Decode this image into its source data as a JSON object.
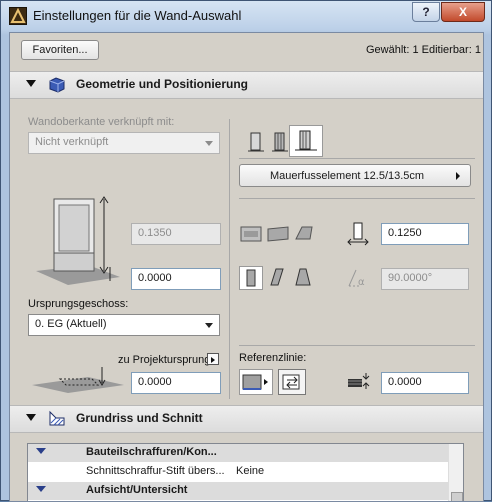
{
  "window": {
    "title": "Einstellungen für die Wand-Auswahl",
    "help_glyph": "?",
    "close_glyph": "X"
  },
  "top": {
    "favorites_label": "Favoriten...",
    "status_text": "Gewählt: 1 Editierbar: 1"
  },
  "section_geometry": {
    "label": "Geometrie und Positionierung"
  },
  "geometry": {
    "top_link_label": "Wandoberkante verknüpft mit:",
    "top_link_value": "Nicht verknüpft",
    "height_value": "0.1350",
    "base_offset_value": "0.0000",
    "home_story_label": "Ursprungsgeschoss:",
    "home_story_value": "0. EG (Aktuell)",
    "to_project_zero_label": "zu Projektursprung",
    "project_zero_value": "0.0000",
    "composite_label": "Mauerfusselement 12.5/13.5cm",
    "thickness_value": "0.1250",
    "slant_angle_value": "90.0000°",
    "reference_line_label": "Referenzlinie:",
    "reference_offset_value": "0.0000",
    "accent_color": "#3b5bb5"
  },
  "section_floorplan": {
    "label": "Grundriss und Schnitt"
  },
  "floorplan_list": {
    "rows": [
      {
        "label": "Bauteilschraffuren/Kon...",
        "value": "",
        "type": "group"
      },
      {
        "label": "Schnittschraffur-Stift übers...",
        "value": "Keine",
        "type": "item"
      },
      {
        "label": "Aufsicht/Untersicht",
        "value": "",
        "type": "group"
      }
    ]
  }
}
